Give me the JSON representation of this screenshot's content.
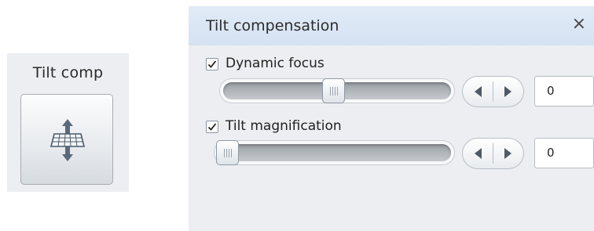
{
  "tool_group": {
    "title": "Tilt comp",
    "button_icon": "tilt-compensation-icon"
  },
  "panel": {
    "title": "Tilt compensation",
    "close_glyph": "×",
    "dynamic_focus": {
      "label": "Dynamic focus",
      "checked": true,
      "slider_level_fraction": 0.5,
      "value": "0"
    },
    "tilt_magnification": {
      "label": "Tilt magnification",
      "checked": true,
      "slider_level_fraction": 0.0,
      "value": "0"
    }
  },
  "colors": {
    "header_bg": "#d8e4f3",
    "panel_bg": "#eceef1",
    "icon_accent": "#4a5a6c"
  }
}
